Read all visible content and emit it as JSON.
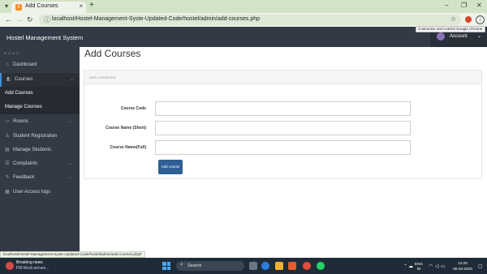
{
  "browser": {
    "tab_title": "Add Courses",
    "tab_favicon": "X",
    "new_tab_label": "+",
    "url": "localhost/Hostel-Management-Syste-Updated-Code/hostel/admin/add-courses.php",
    "tooltip": "Customize and control Google Chrome",
    "status_url": "localhost/Hostel-Management-Syste-Updated-Code/hostel/admin/add-courses.php#"
  },
  "app": {
    "title": "Hostel Management System",
    "account_label": "Account"
  },
  "sidebar": {
    "heading": "M E N U",
    "items": [
      {
        "label": "Dashboard",
        "icon": "dashboard-icon"
      },
      {
        "label": "Courses",
        "icon": "courses-icon"
      },
      {
        "label": "Add Courses"
      },
      {
        "label": "Manage Courses"
      },
      {
        "label": "Rooms",
        "icon": "rooms-icon"
      },
      {
        "label": "Student Registration",
        "icon": "user-icon"
      },
      {
        "label": "Manage Students",
        "icon": "students-icon"
      },
      {
        "label": "Complaints",
        "icon": "complaints-icon"
      },
      {
        "label": "Feedback",
        "icon": "feedback-icon"
      },
      {
        "label": "User Access logs",
        "icon": "logs-icon"
      }
    ]
  },
  "main": {
    "page_title": "Add Courses",
    "panel_heading": "ADD COURSES",
    "fields": [
      {
        "label": "Course Code",
        "value": ""
      },
      {
        "label": "Course Name (Short)",
        "value": ""
      },
      {
        "label": "Course Name(Full)",
        "value": ""
      }
    ],
    "submit_label": "Add course"
  },
  "taskbar": {
    "news_title": "Breaking news",
    "news_subtitle": "PM Modi arrives...",
    "search_placeholder": "Search",
    "language_top": "ENG",
    "language_bottom": "IN",
    "time": "12:25",
    "date": "05-02-2025"
  },
  "colors": {
    "header_bg": "#323a45",
    "sidebar_bg": "#343a43",
    "active_accent": "#3f8fd6",
    "button_bg": "#2f5f93",
    "tab_strip": "#d3e3c7"
  }
}
